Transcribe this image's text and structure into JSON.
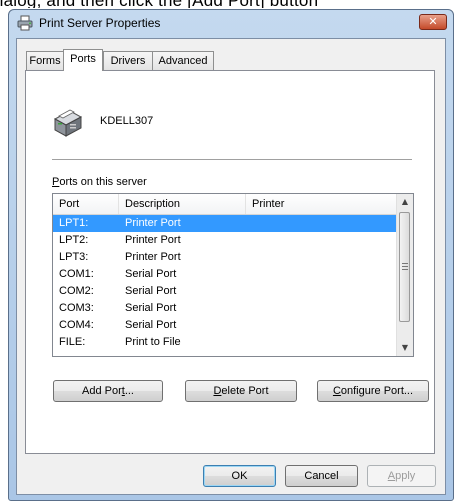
{
  "caption_fragment": "dialog, and then click the [Add Port] button",
  "window": {
    "title": "Print Server Properties",
    "close_glyph": "✕"
  },
  "tabs": [
    {
      "label": "Forms"
    },
    {
      "label": "Ports"
    },
    {
      "label": "Drivers"
    },
    {
      "label": "Advanced"
    }
  ],
  "active_tab": "Ports",
  "server": {
    "name": "KDELL307",
    "icon": "printer-server-icon"
  },
  "ports_section": {
    "label_first": "P",
    "label_rest": "orts on this server"
  },
  "table": {
    "columns": [
      "Port",
      "Description",
      "Printer"
    ],
    "rows": [
      {
        "port": "LPT1:",
        "description": "Printer Port",
        "printer": "",
        "selected": true
      },
      {
        "port": "LPT2:",
        "description": "Printer Port",
        "printer": ""
      },
      {
        "port": "LPT3:",
        "description": "Printer Port",
        "printer": ""
      },
      {
        "port": "COM1:",
        "description": "Serial Port",
        "printer": ""
      },
      {
        "port": "COM2:",
        "description": "Serial Port",
        "printer": ""
      },
      {
        "port": "COM3:",
        "description": "Serial Port",
        "printer": ""
      },
      {
        "port": "COM4:",
        "description": "Serial Port",
        "printer": ""
      },
      {
        "port": "FILE:",
        "description": "Print to File",
        "printer": ""
      }
    ]
  },
  "buttons": {
    "add_port_a": "Add Por",
    "add_port_u": "t",
    "add_port_b": "...",
    "delete_port_u": "D",
    "delete_port_b": "elete Port",
    "configure_port_u": "C",
    "configure_port_b": "onfigure Port...",
    "ok": "OK",
    "cancel": "Cancel",
    "apply_u": "A",
    "apply_b": "pply"
  },
  "colors": {
    "selection": "#3399ff",
    "close_button": "#c44a2a",
    "frame": "#aac6e6"
  }
}
